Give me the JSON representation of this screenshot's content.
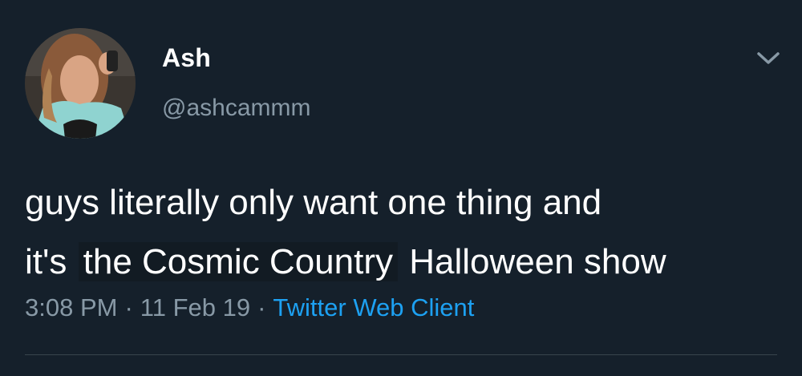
{
  "tweet": {
    "display_name": "Ash",
    "handle": "@ashcammm",
    "text_line1": "guys literally only want one thing and",
    "text_line2_prefix": "it's",
    "text_line2_highlight": "the Cosmic Country",
    "text_line2_suffix": "Halloween show",
    "time": "3:08 PM",
    "date": "11 Feb 19",
    "separator": "·",
    "source": "Twitter Web Client"
  },
  "icons": {
    "more_menu": "chevron-down-icon",
    "avatar": "profile-photo"
  },
  "colors": {
    "background": "#15202b",
    "text": "#ffffff",
    "secondary_text": "#8899a6",
    "link": "#1da1f2",
    "divider": "#38444d"
  }
}
